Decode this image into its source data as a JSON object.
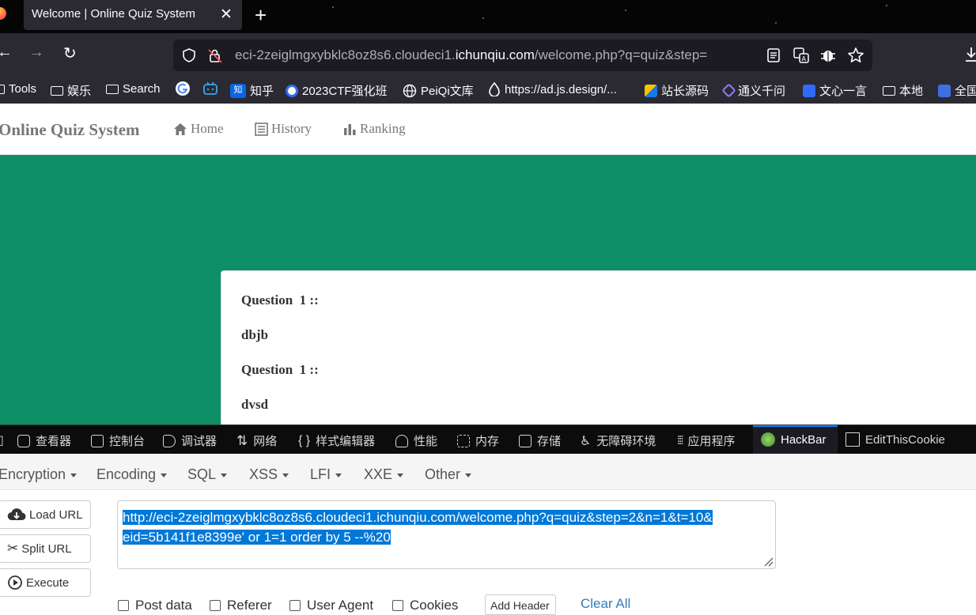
{
  "browser": {
    "tab_title": "Welcome | Online Quiz System",
    "tab_close": "✕",
    "new_tab": "+",
    "url_prefix": "eci-2zeiglmgxybklc8oz8s6.cloudeci1.",
    "url_domain": "ichunqiu.com",
    "url_suffix": "/welcome.php?q=quiz&step="
  },
  "bookmarks": [
    {
      "label": "Tools",
      "icon": "folder-icon"
    },
    {
      "label": "娱乐",
      "icon": "folder-icon"
    },
    {
      "label": "Search",
      "icon": "folder-icon"
    },
    {
      "label": "",
      "icon": "google-icon"
    },
    {
      "label": "",
      "icon": "bilibili-icon"
    },
    {
      "label": "知乎",
      "icon": "zhihu-icon"
    },
    {
      "label": "2023CTF强化班",
      "icon": "baidu-icon"
    },
    {
      "label": "PeiQi文库",
      "icon": "globe-icon"
    },
    {
      "label": "https://ad.js.design/...",
      "icon": "drop-icon"
    },
    {
      "label": "站长源码",
      "icon": "site-icon"
    },
    {
      "label": "通义千问",
      "icon": "tongyi-icon"
    },
    {
      "label": "文心一言",
      "icon": "wenxin-icon"
    },
    {
      "label": "本地",
      "icon": "folder-icon"
    },
    {
      "label": "全国",
      "icon": "app-icon"
    }
  ],
  "site": {
    "brand": "Online Quiz System",
    "nav": [
      {
        "label": "Home",
        "icon": "home-icon"
      },
      {
        "label": "History",
        "icon": "list-icon"
      },
      {
        "label": "Ranking",
        "icon": "bar-chart-icon"
      }
    ],
    "questions": [
      {
        "heading": "Question  1 ::",
        "text": "dbjb"
      },
      {
        "heading": "Question  1 ::",
        "text": "dvsd"
      }
    ]
  },
  "devtools": {
    "tabs": [
      {
        "label": "查看器",
        "icon": "inspector-icon"
      },
      {
        "label": "控制台",
        "icon": "console-icon"
      },
      {
        "label": "调试器",
        "icon": "debugger-icon"
      },
      {
        "label": "网络",
        "icon": "network-icon"
      },
      {
        "label": "样式编辑器",
        "icon": "style-editor-icon"
      },
      {
        "label": "性能",
        "icon": "performance-icon"
      },
      {
        "label": "内存",
        "icon": "memory-icon"
      },
      {
        "label": "存储",
        "icon": "storage-icon"
      },
      {
        "label": "无障碍环境",
        "icon": "accessibility-icon"
      },
      {
        "label": "应用程序",
        "icon": "application-icon"
      },
      {
        "label": "HackBar",
        "icon": "hackbar-icon"
      },
      {
        "label": "EditThisCookie",
        "icon": "cookie-icon"
      }
    ]
  },
  "hackbar": {
    "menu": [
      "Encryption",
      "Encoding",
      "SQL",
      "XSS",
      "LFI",
      "XXE",
      "Other"
    ],
    "load_url": "Load URL",
    "split_url": "Split URL",
    "execute": "Execute",
    "url_line1": "http://eci-2zeiglmgxybklc8oz8s6.cloudeci1.ichunqiu.com/welcome.php?q=quiz&step=2&n=1&t=10&",
    "url_line2": "eid=5b141f1e8399e' or 1=1 order by 5 --%20",
    "options": [
      "Post data",
      "Referer",
      "User Agent",
      "Cookies"
    ],
    "add_header": "Add Header",
    "clear_all": "Clear All"
  }
}
